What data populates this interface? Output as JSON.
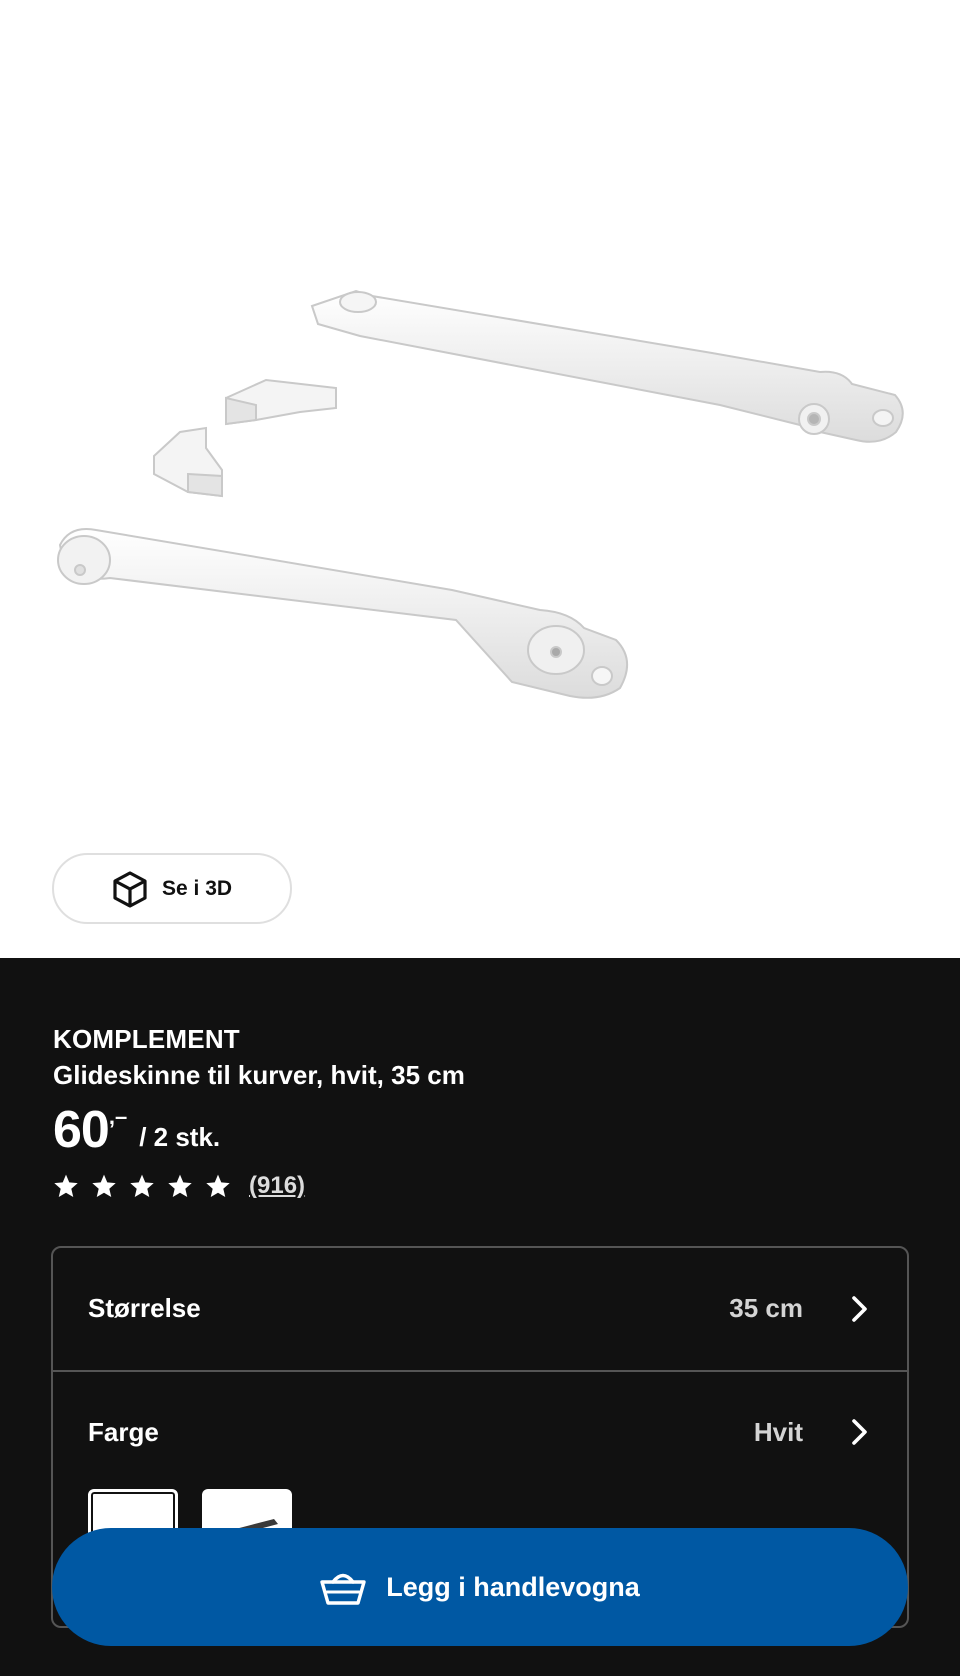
{
  "gallery": {
    "view_3d_label": "Se i 3D",
    "view_3d_icon": "cube-icon"
  },
  "product": {
    "brand": "KOMPLEMENT",
    "description": "Glideskinne til kurver, hvit, 35 cm",
    "price_integer": "60",
    "price_decimal": ",–",
    "price_unit": "/ 2 stk.",
    "rating_stars": 5,
    "rating_max": 5,
    "review_count": "(916)"
  },
  "options": {
    "size": {
      "label": "Størrelse",
      "value": "35 cm",
      "icon": "chevron-right-icon"
    },
    "color": {
      "label": "Farge",
      "value": "Hvit",
      "icon": "chevron-right-icon",
      "swatches": [
        {
          "name": "Hvit",
          "selected": true
        },
        {
          "name": "Svart",
          "selected": false
        }
      ]
    }
  },
  "cart": {
    "add_label": "Legg i handlevogna",
    "icon": "basket-icon",
    "button_color": "#0058a3"
  },
  "colors": {
    "background_dark": "#111111",
    "image_background": "#ffffff",
    "accent": "#0058a3"
  }
}
